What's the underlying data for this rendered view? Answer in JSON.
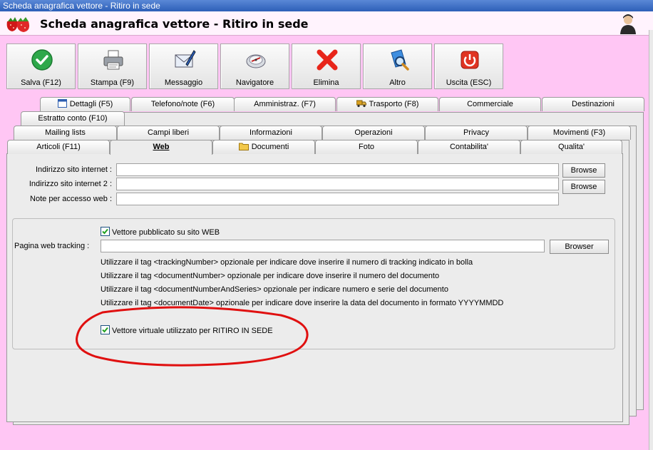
{
  "window": {
    "title": "Scheda anagrafica vettore - Ritiro in sede"
  },
  "header": {
    "title": "Scheda anagrafica vettore - Ritiro in sede"
  },
  "toolbar": [
    {
      "label": "Salva (F12)",
      "icon": "check-icon"
    },
    {
      "label": "Stampa (F9)",
      "icon": "printer-icon"
    },
    {
      "label": "Messaggio",
      "icon": "envelope-icon"
    },
    {
      "label": "Navigatore",
      "icon": "navigator-icon"
    },
    {
      "label": "Elimina",
      "icon": "delete-x-icon"
    },
    {
      "label": "Altro",
      "icon": "search-doc-icon"
    },
    {
      "label": "Uscita (ESC)",
      "icon": "exit-icon"
    }
  ],
  "tabs": {
    "row1": [
      "Dettagli (F5)",
      "Telefono/note (F6)",
      "Amministraz. (F7)",
      "Trasporto (F8)",
      "Commerciale",
      "Destinazioni"
    ],
    "row2": [
      "Estratto conto (F10)"
    ],
    "row3": [
      "Mailing lists",
      "Campi liberi",
      "Informazioni",
      "Operazioni",
      "Privacy",
      "Movimenti (F3)"
    ],
    "row4": [
      "Articoli (F11)",
      "Web",
      "Documenti",
      "Foto",
      "Contabilita'",
      "Qualita'"
    ],
    "active": "Web"
  },
  "web": {
    "site_label": "Indirizzo sito internet :",
    "site_value": "",
    "site2_label": "Indirizzo sito internet 2 :",
    "site2_value": "",
    "notes_label": "Note per accesso web :",
    "notes_value": "",
    "browse_label": "Browse",
    "published_label": "Vettore pubblicato su sito WEB",
    "published_checked": true,
    "tracking_label": "Pagina web tracking :",
    "tracking_value": "",
    "browser_label": "Browser",
    "info": [
      "Utilizzare il tag <trackingNumber> opzionale per indicare dove inserire il numero di tracking indicato in bolla",
      "Utilizzare il tag <documentNumber> opzionale per indicare dove inserire il numero del documento",
      "Utilizzare il tag <documentNumberAndSeries> opzionale per indicare numero e serie del documento",
      "Utilizzare il tag <documentDate> opzionale per indicare dove inserire la data del documento in formato YYYYMMDD"
    ],
    "virtual_label": "Vettore virtuale utilizzato per RITIRO IN SEDE",
    "virtual_checked": true
  },
  "colors": {
    "background": "#ffc6f4",
    "highlight": "#e01010",
    "titlebar": "#2d5fb8"
  }
}
